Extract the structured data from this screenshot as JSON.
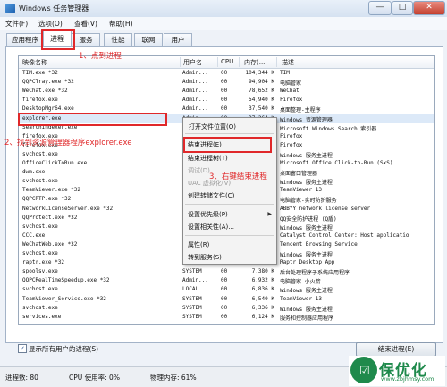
{
  "window": {
    "title": "Windows 任务管理器",
    "min": "—",
    "max": "□",
    "close": "✕"
  },
  "menu": [
    "文件(F)",
    "选项(O)",
    "查看(V)",
    "帮助(H)"
  ],
  "tabs": [
    "应用程序",
    "进程",
    "服务",
    "性能",
    "联网",
    "用户"
  ],
  "columns": {
    "image": "映像名称",
    "user": "用户名",
    "cpu": "CPU",
    "mem": "内存(...",
    "desc": "描述"
  },
  "rows": [
    {
      "image": "TIM.exe *32",
      "user": "Admin...",
      "cpu": "00",
      "mem": "104,344 K",
      "desc": "TIM"
    },
    {
      "image": "QQPCTray.exe *32",
      "user": "Admin...",
      "cpu": "00",
      "mem": "94,904 K",
      "desc": "电脑管家"
    },
    {
      "image": "WeChat.exe *32",
      "user": "Admin...",
      "cpu": "00",
      "mem": "78,652 K",
      "desc": "WeChat"
    },
    {
      "image": "firefox.exe",
      "user": "Admin...",
      "cpu": "00",
      "mem": "54,940 K",
      "desc": "Firefox"
    },
    {
      "image": "DesktopMgr64.exe",
      "user": "Admin...",
      "cpu": "00",
      "mem": "37,540 K",
      "desc": "桌面整理-主程序"
    },
    {
      "image": "explorer.exe",
      "user": "Admin...",
      "cpu": "00",
      "mem": "37,264 K",
      "desc": "Windows 资源管理器"
    },
    {
      "image": "SearchIndexer.exe",
      "user": "",
      "cpu": "",
      "mem": "",
      "desc": "Microsoft Windows Search 索引器"
    },
    {
      "image": "firefox.exe",
      "user": "",
      "cpu": "",
      "mem": "",
      "desc": "Firefox"
    },
    {
      "image": "firefox.exe",
      "user": "",
      "cpu": "",
      "mem": "",
      "desc": "Firefox"
    },
    {
      "image": "svchost.exe",
      "user": "",
      "cpu": "",
      "mem": "",
      "desc": "Windows 服务主进程"
    },
    {
      "image": "OfficeClickToRun.exe",
      "user": "",
      "cpu": "",
      "mem": "",
      "desc": "Microsoft Office Click-to-Run (SxS)"
    },
    {
      "image": "dwm.exe",
      "user": "",
      "cpu": "",
      "mem": "",
      "desc": "桌面窗口管理器"
    },
    {
      "image": "svchost.exe",
      "user": "",
      "cpu": "",
      "mem": "",
      "desc": "Windows 服务主进程"
    },
    {
      "image": "TeamViewer.exe *32",
      "user": "",
      "cpu": "",
      "mem": "",
      "desc": "TeamViewer 13"
    },
    {
      "image": "QQPCRTP.exe *32",
      "user": "",
      "cpu": "",
      "mem": "",
      "desc": "电脑管家-实时防护服务"
    },
    {
      "image": "NetworkLicenseServer.exe *32",
      "user": "",
      "cpu": "",
      "mem": "",
      "desc": "ABBYY network license server"
    },
    {
      "image": "QQProtect.exe *32",
      "user": "",
      "cpu": "",
      "mem": "",
      "desc": "QQ安全防护进程 (Q盾)"
    },
    {
      "image": "svchost.exe",
      "user": "",
      "cpu": "",
      "mem": "",
      "desc": "Windows 服务主进程"
    },
    {
      "image": "CCC.exe",
      "user": "",
      "cpu": "",
      "mem": "",
      "desc": "Catalyst Control Center: Host applicatio"
    },
    {
      "image": "WeChatWeb.exe *32",
      "user": "",
      "cpu": "",
      "mem": "",
      "desc": "Tencent Browsing Service"
    },
    {
      "image": "svchost.exe",
      "user": "",
      "cpu": "",
      "mem": "",
      "desc": "Windows 服务主进程"
    },
    {
      "image": "raptr.exe *32",
      "user": "Admin...",
      "cpu": "00",
      "mem": "7,640 K",
      "desc": "Raptr Desktop App"
    },
    {
      "image": "spoolsv.exe",
      "user": "SYSTEM",
      "cpu": "00",
      "mem": "7,380 K",
      "desc": "后台处理程序子系统应用程序"
    },
    {
      "image": "QQPCRealTimeSpeedup.exe *32",
      "user": "Admin...",
      "cpu": "00",
      "mem": "6,932 K",
      "desc": "电脑管家-小火箭"
    },
    {
      "image": "svchost.exe",
      "user": "LOCAL...",
      "cpu": "00",
      "mem": "6,836 K",
      "desc": "Windows 服务主进程"
    },
    {
      "image": "TeamViewer_Service.exe *32",
      "user": "SYSTEM",
      "cpu": "00",
      "mem": "6,540 K",
      "desc": "TeamViewer 13"
    },
    {
      "image": "svchost.exe",
      "user": "SYSTEM",
      "cpu": "00",
      "mem": "6,336 K",
      "desc": "Windows 服务主进程"
    },
    {
      "image": "services.exe",
      "user": "SYSTEM",
      "cpu": "00",
      "mem": "6,124 K",
      "desc": "服务和控制器应用程序"
    }
  ],
  "context_menu": [
    {
      "label": "打开文件位置(O)",
      "disabled": false
    },
    {
      "label": "结束进程(E)",
      "disabled": false
    },
    {
      "label": "结束进程树(T)",
      "disabled": false
    },
    {
      "label": "调试(D)",
      "disabled": true
    },
    {
      "label": "UAC 虚拟化(V)",
      "disabled": true
    },
    {
      "label": "创建转储文件(C)",
      "disabled": false
    },
    {
      "label": "设置优先级(P)",
      "disabled": false,
      "submenu": true
    },
    {
      "label": "设置相关性(A)...",
      "disabled": false
    },
    {
      "label": "属性(R)",
      "disabled": false
    },
    {
      "label": "转到服务(S)",
      "disabled": false
    }
  ],
  "annotations": {
    "step1": "1、点到进程",
    "step2": "2、找到资源管理器程序explorer.exe",
    "step3": "3、右键结束进程"
  },
  "checkbox": {
    "checked_mark": "✓",
    "label": "显示所有用户的进程(S)"
  },
  "end_button": "结束进程(E)",
  "status": {
    "processes": "进程数: 80",
    "cpu": "CPU 使用率: 0%",
    "memory": "物理内存: 61%"
  },
  "watermark": {
    "text": "保优化",
    "url": "www.zbjhmsy.com"
  },
  "colors": {
    "annotation_red": "#e0282a",
    "selected_row": "#dce9f8",
    "logo_green": "#1f8a4c"
  }
}
